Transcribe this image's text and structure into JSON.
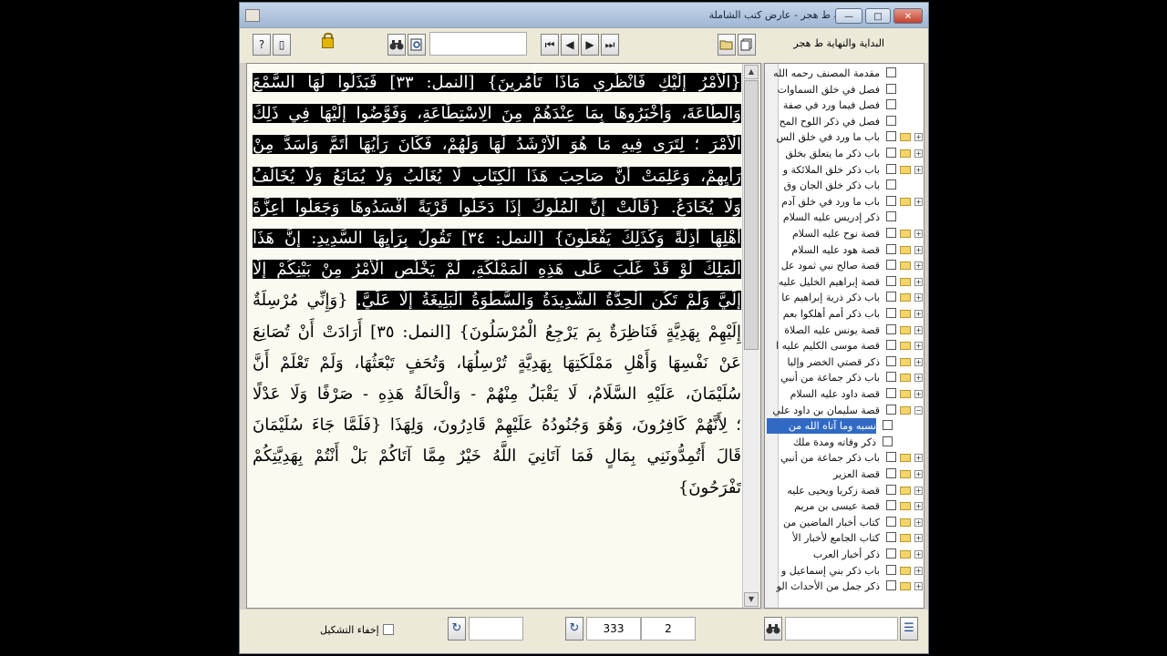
{
  "window": {
    "title": "البداية والنهاية ط هجر - عارض كتب الشاملة",
    "controls": {
      "minimize": "—",
      "maximize": "□",
      "close": "✕"
    }
  },
  "toolbar": {
    "help_icon": "?",
    "page_icon": "▯",
    "book_title": "البداية والنهاية ط هجر",
    "nav": {
      "first": "⏮",
      "prev": "◀",
      "next": "▶",
      "last": "⏭"
    }
  },
  "text_lines": [
    {
      "pre": "",
      "hl": "{الْأَمْرُ إِلَيْكِ فَانْظُرِي مَاذَا تَأْمُرِينَ} [النمل: ٣٣] فَبَذَلُوا لَهَا السَّمْعَ",
      "post": ""
    },
    {
      "pre": "",
      "hl": "وَالطَّاعَةَ، وَأَخْبَرُوهَا بِمَا عِنْدَهُمْ مِنَ الِاسْتِطَاعَةِ، وَفَوَّضُوا إِلَيْهَا فِي ذَلِكَ",
      "post": ""
    },
    {
      "pre": "",
      "hl": "الْأَمْرَ ؛ لِتَرَى فِيهِ مَا هُوَ الْأَرْشَدُ لَهَا وَلَهُمْ، فَكَانَ رَأْيُهَا أَتَمَّ وَأَسَدَّ مِنْ",
      "post": ""
    },
    {
      "pre": "",
      "hl": "رَأْيِهِمْ، وَعَلِمَتْ أَنَّ صَاحِبَ هَذَا الْكِتَابِ لَا يُغَالَبُ وَلَا يُمَانَعُ وَلَا يُخَالَفُ",
      "post": ""
    },
    {
      "pre": "",
      "hl": "وَلَا يُخَادَعُ. {قَالَتْ إِنَّ الْمُلُوكَ إِذَا دَخَلُوا قَرْيَةً أَفْسَدُوهَا وَجَعَلُوا أَعِزَّةَ",
      "post": ""
    },
    {
      "pre": "",
      "hl": "أَهْلِهَا أَذِلَّةً وَكَذَلِكَ يَفْعَلُونَ} [النمل: ٣٤] تَقُولُ بِرَأْيِهَا السَّدِيدِ: إِنَّ هَذَا",
      "post": ""
    },
    {
      "pre": "",
      "hl": "الْمَلِكَ لَوْ قَدْ غَلَبَ عَلَى هَذِهِ الْمَمْلَكَةِ، لَمْ يَخْلُصِ الْأَمْرُ مِنْ بَيْنِكُمْ إِلَّا",
      "post": ""
    },
    {
      "pre": "",
      "hl": "إِلَيَّ وَلَمْ تَكُنِ الْحِدَّةُ الشَّدِيدَةُ وَالسَّطْوَةُ الْبَلِيغَةُ إِلَّا عَلَيَّ.",
      "post": " {وَإِنِّي مُرْسِلَةٌ"
    },
    {
      "pre": "",
      "hl": "",
      "post": "إِلَيْهِمْ بِهَدِيَّةٍ فَنَاظِرَةٌ بِمَ يَرْجِعُ الْمُرْسَلُونَ} [النمل: ٣٥] أَرَادَتْ أَنْ تُصَانِعَ"
    },
    {
      "pre": "",
      "hl": "",
      "post": "عَنْ نَفْسِهَا وَأَهْلِ مَمْلَكَتِهَا بِهَدِيَّةٍ تُرْسِلُهَا، وَتُحَفٍ تَبْعَثُهَا، وَلَمْ تَعْلَمْ أَنَّ"
    },
    {
      "pre": "",
      "hl": "",
      "post": "سُلَيْمَانَ، عَلَيْهِ السَّلَامُ، لَا يَقْبَلُ مِنْهُمْ - وَالْحَالَةُ هَذِهِ - صَرْفًا وَلَا عَدْلًا"
    },
    {
      "pre": "",
      "hl": "",
      "post": "؛ لِأَنَّهُمْ كَافِرُونَ، وَهُوَ وَجُنُودُهُ عَلَيْهِمْ قَادِرُونَ، وَلِهَذَا {فَلَمَّا جَاءَ سُلَيْمَانَ"
    },
    {
      "pre": "",
      "hl": "",
      "post": "قَالَ أَتُمِدُّونَنِي بِمَالٍ فَمَا آتَانِيَ اللَّهُ خَيْرٌ مِمَّا آتَاكُمْ بَلْ أَنْتُمْ بِهَدِيَّتِكُمْ"
    },
    {
      "pre": "",
      "hl": "",
      "post": "تَفْرَحُونَ}"
    }
  ],
  "tree": {
    "items": [
      {
        "label": "مقدمة المصنف رحمه الله",
        "folder": false,
        "expander": ""
      },
      {
        "label": "فصل في خلق السماوات",
        "folder": false,
        "expander": ""
      },
      {
        "label": "فصل فيما ورد في صفة",
        "folder": false,
        "expander": ""
      },
      {
        "label": "فصل في ذكر اللوح المح",
        "folder": false,
        "expander": ""
      },
      {
        "label": "باب ما ورد في خلق الس",
        "folder": true,
        "expander": "+"
      },
      {
        "label": "باب ذكر ما يتعلق بخلق",
        "folder": true,
        "expander": "+"
      },
      {
        "label": "باب ذكر خلق الملائكة و",
        "folder": true,
        "expander": "+"
      },
      {
        "label": "باب ذكر خلق الجان وق",
        "folder": false,
        "expander": ""
      },
      {
        "label": "باب ما ورد في خلق آدم",
        "folder": true,
        "expander": "+"
      },
      {
        "label": "ذكر إدريس عليه السلام",
        "folder": false,
        "expander": ""
      },
      {
        "label": "قصة نوح عليه السلام",
        "folder": true,
        "expander": "+"
      },
      {
        "label": "قصة هود عليه السلام",
        "folder": true,
        "expander": "+"
      },
      {
        "label": "قصة صالح نبي ثمود عل",
        "folder": true,
        "expander": "+"
      },
      {
        "label": "قصة إبراهيم الخليل عليه",
        "folder": true,
        "expander": "+"
      },
      {
        "label": "باب ذكر ذرية إبراهيم عا",
        "folder": true,
        "expander": "+"
      },
      {
        "label": "باب ذكر أمم أهلكوا بعم",
        "folder": true,
        "expander": "+"
      },
      {
        "label": "قصة يونس عليه الصلاة",
        "folder": true,
        "expander": "+"
      },
      {
        "label": "قصة موسى الكليم عليه ا",
        "folder": true,
        "expander": "+"
      },
      {
        "label": "ذكر قصتي الخضر وإليا",
        "folder": true,
        "expander": "+"
      },
      {
        "label": "باب ذكر جماعة من أنبي",
        "folder": true,
        "expander": "+"
      },
      {
        "label": "قصة داود عليه السلام",
        "folder": true,
        "expander": "+"
      },
      {
        "label": "قصة سليمان بن داود علي",
        "folder": true,
        "expander": "−"
      },
      {
        "label": "نسبه وما آتاه الله من",
        "folder": false,
        "expander": "",
        "selected": true,
        "child": true
      },
      {
        "label": "ذكر وفاته ومدة ملك",
        "folder": false,
        "expander": "",
        "child": true
      },
      {
        "label": "باب ذكر جماعة من أنبي",
        "folder": true,
        "expander": "+"
      },
      {
        "label": "قصة العزير",
        "folder": true,
        "expander": "+"
      },
      {
        "label": "قصة زكريا ويحيى عليه",
        "folder": true,
        "expander": "+"
      },
      {
        "label": "قصة عيسى بن مريم",
        "folder": true,
        "expander": "+"
      },
      {
        "label": "كتاب أخبار الماضين من",
        "folder": true,
        "expander": "+"
      },
      {
        "label": "كتاب الجامع لأخبار الأ",
        "folder": true,
        "expander": "+"
      },
      {
        "label": "ذكر أخبار العرب",
        "folder": true,
        "expander": "+"
      },
      {
        "label": "باب ذكر بني إسماعيل و",
        "folder": true,
        "expander": "+"
      },
      {
        "label": "ذكر جمل من الأحداث الو",
        "folder": true,
        "expander": "+"
      }
    ]
  },
  "bottombar": {
    "hide_diacritics_label": "إخفاء التشكيل",
    "page_number": "333",
    "part_number": "2",
    "go_icon": "↻",
    "search_icon": "🔍"
  }
}
